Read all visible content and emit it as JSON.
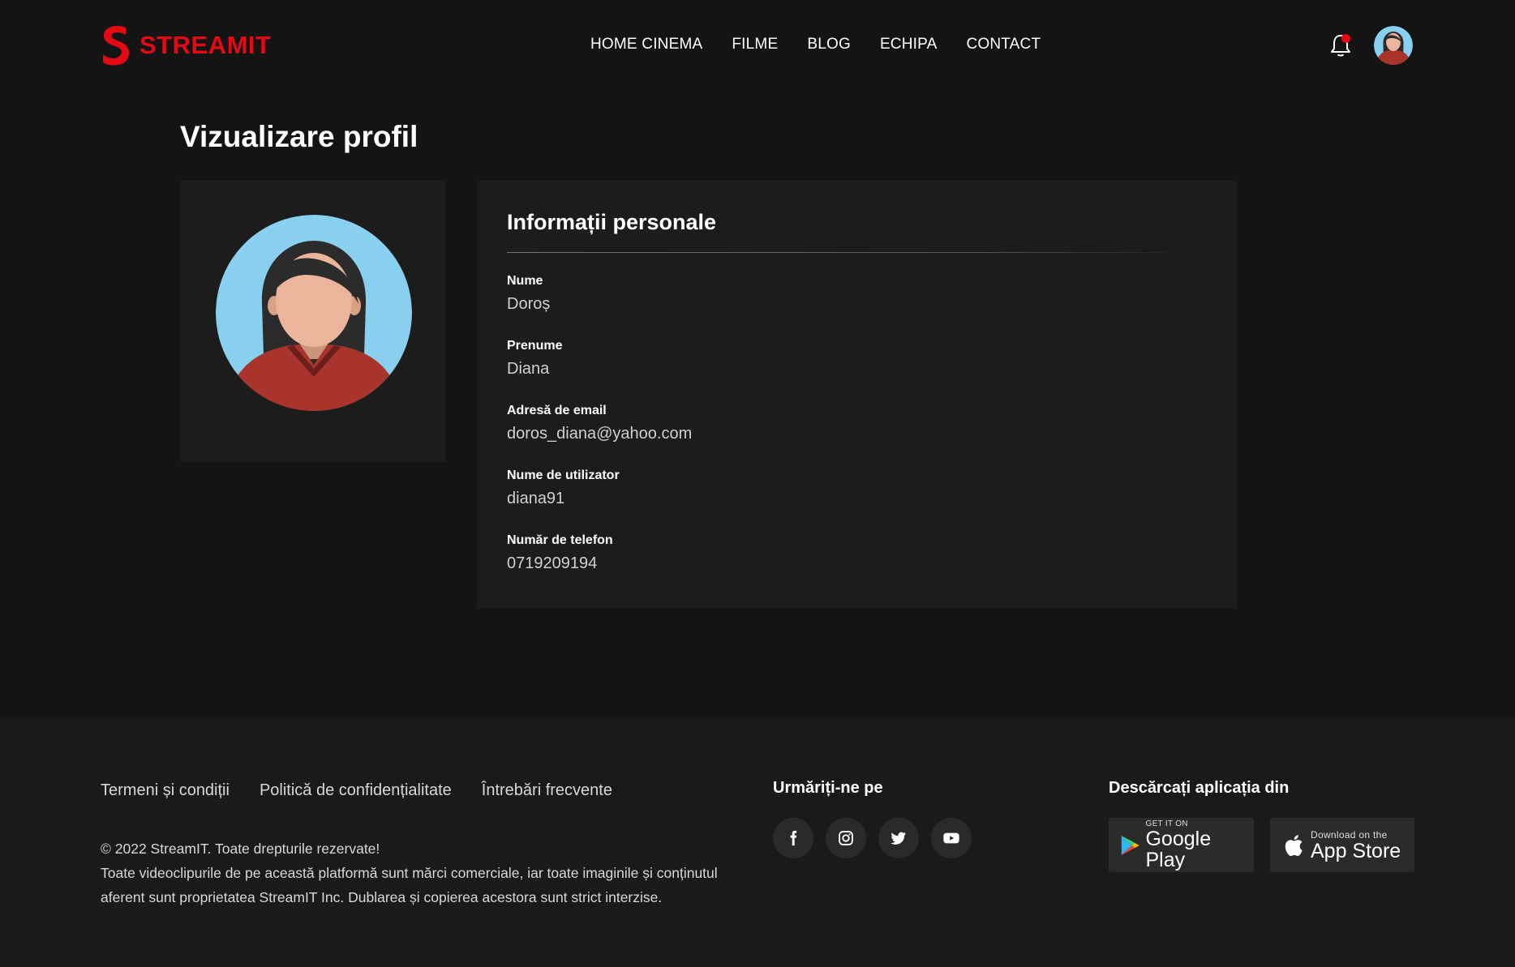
{
  "header": {
    "brand": "STREAMIT",
    "nav": [
      "HOME CINEMA",
      "FILME",
      "BLOG",
      "ECHIPA",
      "CONTACT"
    ]
  },
  "page": {
    "title": "Vizualizare profil"
  },
  "info": {
    "title": "Informații personale",
    "fields": [
      {
        "label": "Nume",
        "value": "Doroș"
      },
      {
        "label": "Prenume",
        "value": "Diana"
      },
      {
        "label": "Adresă de email",
        "value": "doros_diana@yahoo.com"
      },
      {
        "label": "Nume de utilizator",
        "value": "diana91"
      },
      {
        "label": "Număr de telefon",
        "value": "0719209194"
      }
    ]
  },
  "footer": {
    "links": [
      "Termeni și condiții",
      "Politică de confidențialitate",
      "Întrebări frecvente"
    ],
    "copyright_line1": "© 2022 StreamIT. Toate drepturile rezervate!",
    "copyright_line2": "Toate videoclipurile de pe această platformă sunt mărci comerciale, iar toate imaginile și conținutul aferent sunt proprietatea StreamIT Inc. Dublarea și copierea acestora sunt strict interzise.",
    "follow_title": "Urmăriți-ne pe",
    "socials": [
      "facebook-icon",
      "instagram-icon",
      "twitter-icon",
      "youtube-icon"
    ],
    "download_title": "Descărcați aplicația din",
    "google_small": "GET IT ON",
    "google_big": "Google Play",
    "apple_small": "Download on the",
    "apple_big": "App Store"
  },
  "colors": {
    "accent": "#e50914",
    "background": "#141414",
    "card": "#1c1c1c",
    "avatar_bg": "#89cff0"
  }
}
